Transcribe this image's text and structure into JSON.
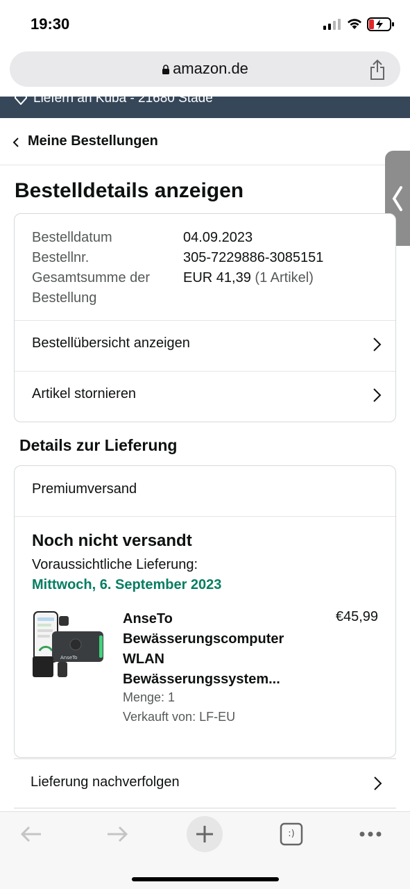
{
  "status_bar": {
    "time": "19:30"
  },
  "browser": {
    "url": "amazon.de"
  },
  "location_bar": {
    "text": "Liefern an Kuba - 21680 Stade"
  },
  "nav": {
    "back_label": "Meine Bestellungen"
  },
  "page": {
    "title": "Bestelldetails anzeigen"
  },
  "order_summary": {
    "rows": [
      {
        "key": "Bestelldatum",
        "value": "04.09.2023"
      },
      {
        "key": "Bestellnr.",
        "value": "305-7229886-3085151"
      }
    ],
    "total_key": "Gesamtsumme der Bestellung",
    "total_value": "EUR 41,39",
    "total_items": "(1 Artikel)",
    "links": [
      {
        "label": "Bestellübersicht anzeigen"
      },
      {
        "label": "Artikel stornieren"
      }
    ]
  },
  "delivery": {
    "section_title": "Details zur Lieferung",
    "shipping_method": "Premiumversand",
    "status": "Noch nicht versandt",
    "eta_label": "Voraussichtliche Lieferung:",
    "eta_date": "Mittwoch, 6. September 2023",
    "item": {
      "title": "AnseTo Bewässerungscomputer WLAN Bewässerungssystem...",
      "price": "€45,99",
      "quantity": "Menge: 1",
      "seller": "Verkauft von: LF-EU",
      "image_text": "AnseTo"
    },
    "track_label": "Lieferung nachverfolgen"
  },
  "toolbar": {
    "tabs_count": ":)"
  },
  "colors": {
    "location_band": "#37475a",
    "eta_green": "#067d62",
    "border": "#d5d9d9"
  }
}
